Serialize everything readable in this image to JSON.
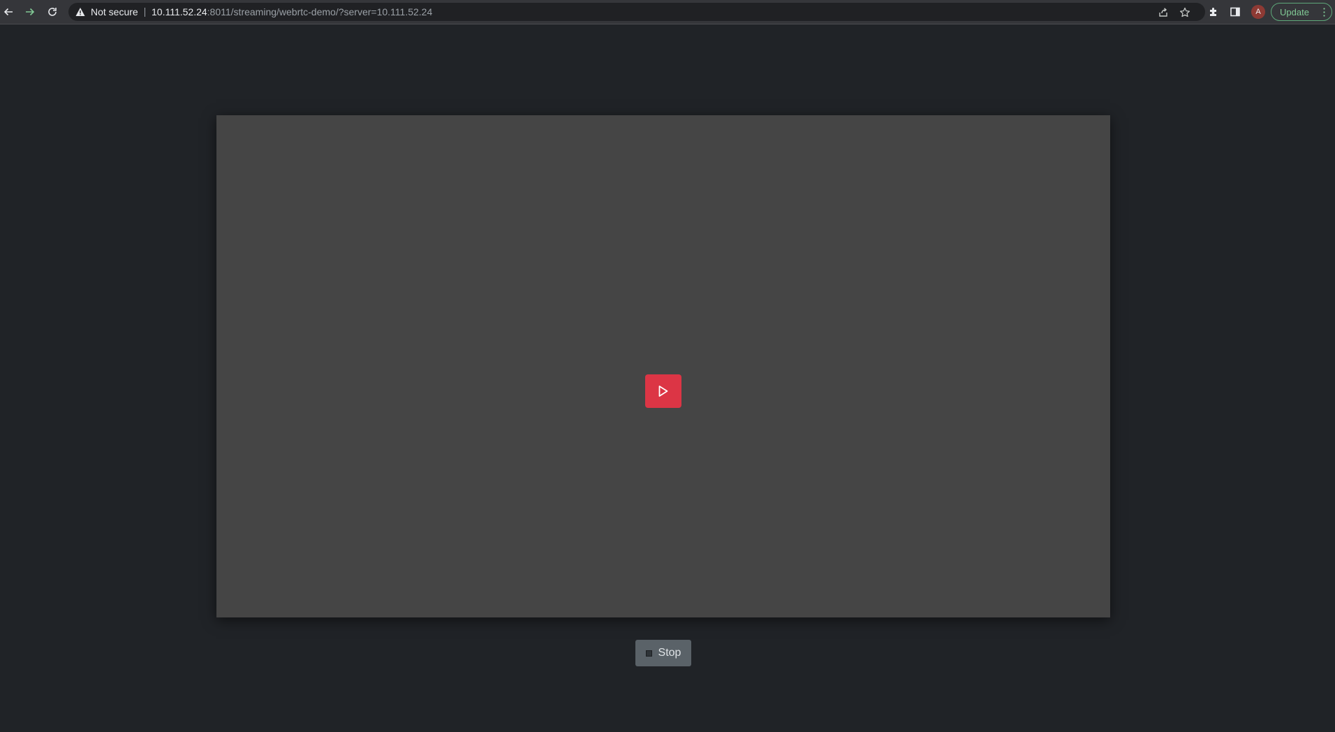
{
  "browser": {
    "security_label": "Not secure",
    "url_host": "10.111.52.24",
    "url_rest": ":8011/streaming/webrtc-demo/?server=10.111.52.24",
    "profile_initial": "A",
    "update_label": "Update",
    "icons": {
      "back": "back-arrow-icon",
      "forward": "forward-arrow-icon",
      "reload": "reload-icon",
      "warning": "warning-icon",
      "share": "share-icon",
      "bookmark": "star-icon",
      "extensions": "puzzle-icon",
      "side_panel": "side-panel-icon"
    }
  },
  "player": {
    "play_icon": "play-icon"
  },
  "controls": {
    "stop_label": "Stop"
  },
  "colors": {
    "page_bg": "#202327",
    "player_bg": "#454545",
    "play_button": "#dc3545",
    "stop_button": "#5a6268",
    "update_accent": "#81c995"
  }
}
